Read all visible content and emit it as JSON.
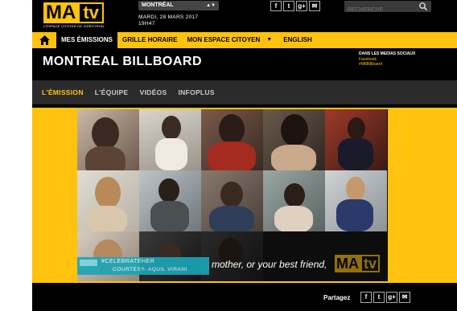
{
  "header": {
    "logo": {
      "ma": "MA",
      "tv": "tv",
      "tagline": "L'ESPACE CITOYEN DE VIDÉOTRON"
    },
    "city": "MONTRÉAL",
    "date_line1": "MARDI, 28 MARS 2017",
    "date_line2": "19H47",
    "social": [
      "f",
      "t",
      "g+",
      "✉"
    ],
    "search_placeholder": "RECHERCHE"
  },
  "nav": {
    "items": [
      {
        "label": "MES ÉMISSIONS",
        "active": true
      },
      {
        "label": "GRILLE HORAIRE",
        "active": false
      },
      {
        "label": "MON ESPACE CITOYEN",
        "active": false
      },
      {
        "label": "ENGLISH",
        "active": false
      }
    ],
    "caret": "▼"
  },
  "show": {
    "title": "MONTREAL BILLBOARD",
    "social_heading": "DANS LES MEDIAS SOCIAUX",
    "social_links": [
      "Facebook",
      "#MtlBillboard"
    ]
  },
  "subnav": {
    "items": [
      {
        "label": "L'ÉMISSION",
        "active": true
      },
      {
        "label": "L'ÉQUIPE",
        "active": false
      },
      {
        "label": "VIDÉOS",
        "active": false
      },
      {
        "label": "INFOPLUS",
        "active": false
      }
    ]
  },
  "video": {
    "caption_tag": "#CELEBRATEHER",
    "caption_credit": "COURTESY- AQUIL VIRANI",
    "subtitle": "mother, or your best friend,",
    "watermark": {
      "ma": "MA",
      "tv": "tv"
    }
  },
  "share": {
    "label": "Partagez",
    "icons": [
      "f",
      "t",
      "g+",
      "✉"
    ]
  },
  "colors": {
    "accent": "#ffc20e",
    "dark": "#000000",
    "subnav_bg": "#2b2b2b",
    "caption": "#1aa6b7"
  }
}
